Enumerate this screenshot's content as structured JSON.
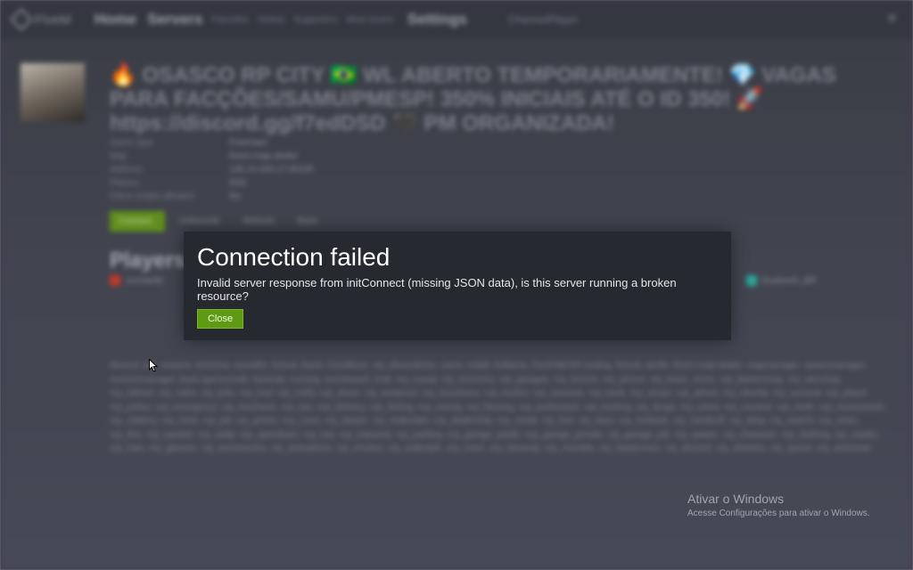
{
  "topbar": {
    "brand": "FiveM",
    "home": "Home",
    "servers": "Servers",
    "sub_links": [
      "Favorites",
      "History",
      "Supporters",
      "Most recent"
    ],
    "settings": "Settings",
    "search": "ChannelPlayer",
    "close_glyph": "✕"
  },
  "server": {
    "title": "🔥 OSASCO RP CITY 🇧🇷 WL ABERTO TEMPORARIAMENTE! 💎 VAGAS PARA FACÇÕES/SAMU/PMESP! 350% INICIAIS ATÉ O ID 350! 🚀 https://discord.gg/f7edDSD 🖤 PM ORGANIZADA!",
    "info": [
      {
        "key": "Game type",
        "value": "Freeroam"
      },
      {
        "key": "Map",
        "value": "fivem-map-skater"
      },
      {
        "key": "Address",
        "value": "145.14.150.17:30120"
      },
      {
        "key": "Players",
        "value": "0/32"
      },
      {
        "key": "Client scripts allowed",
        "value": "No"
      }
    ],
    "actions": [
      "Connect",
      "Unfavorite",
      "Refresh",
      "Back"
    ],
    "players_heading": "Players",
    "player_left": "ourmanbr",
    "player_right": "[hudsonh_BR"
  },
  "resources_text": "discord_log, oswano, bortonrp, esxedfis, fxmod, hwod, Condtions, vrp_discordonm, users, mdall, hotbarrp, FiveFMEDR-routing, fxmod, rpclife, fivem-map-skater, mapmanager, spawnmanager, sessionmanager, basic-gamemode, hardcap, rconlog, scoreboard, chat, vrp_mysql, vrp_inventory, vrp_garages, vrp_homes, vrp_phone, vrp_basic_menu, vrp_barbershop, vrp_skinshop, vrp_tattoos, vrp_radio, vrp_jobs, vrp_hud, vrp_notify, vrp_doors, vrp_weapons, vrp_lscustoms, vrp_trucker, vrp_carwash, vrp_bank, vrp_shops, vrp_admin, vrp_identity, vrp_survival, vrp_player, vrp_police, vrp_emergency, vrp_mechanic, vrp_taxi, vrp_delivery, vrp_fishing, vrp_mining, vrp_farming, vrp_lumberjack, vrp_hunting, vrp_drugs, vrp_weed, vrp_cocaine, vrp_meth, vrp_moneywash, vrp_robbery, vrp_heist, vrp_jail, vrp_prison, vrp_court, vrp_lawyer, vrp_realestate, vrp_dealership, vrp_rental, vrp_fuel, vrp_keys, vrp_lockpick, vrp_handcuff, vrp_drag, vrp_search, vrp_seize, vrp_fine, vrp_wanted, vrp_radar, vrp_speedcam, vrp_tow, vrp_impound, vrp_parking, vrp_garage_public, vrp_garage_private, vrp_garage_job, vrp_spawn, vrp_character, vrp_clothing, vrp_masks, vrp_hats, vrp_glasses, vrp_accessories, vrp_animations, vrp_emotes, vrp_walkstyle, vrp_voice, vrp_tokovoip, vrp_mumble, vrp_loadscreen, vrp_discord, vrp_whitelist, vrp_queue, vrp_anticheat",
  "dialog": {
    "title": "Connection failed",
    "message": "Invalid server response from initConnect (missing JSON data), is this server running a broken resource?",
    "close_label": "Close"
  },
  "windows_activation": {
    "title": "Ativar o Windows",
    "subtitle": "Acesse Configurações para ativar o Windows."
  }
}
